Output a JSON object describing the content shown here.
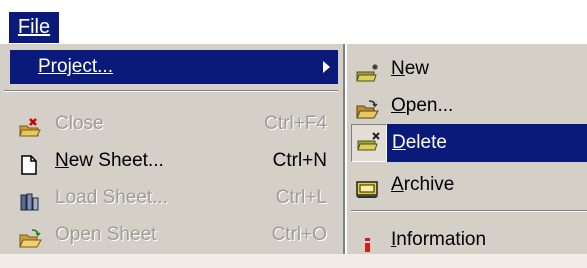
{
  "menubar": {
    "file_label": "File"
  },
  "file_menu": {
    "project_label": "Project...",
    "items": [
      {
        "label": "Close",
        "shortcut": "Ctrl+F4",
        "icon": "close-folder-icon",
        "enabled": false
      },
      {
        "label": "New Sheet...",
        "shortcut": "Ctrl+N",
        "icon": "new-sheet-icon",
        "enabled": true
      },
      {
        "label": "Load Sheet...",
        "shortcut": "Ctrl+L",
        "icon": "load-sheet-icon",
        "enabled": false
      },
      {
        "label": "Open Sheet",
        "shortcut": "Ctrl+O",
        "icon": "open-folder-icon",
        "enabled": false
      }
    ]
  },
  "project_submenu": {
    "items": [
      {
        "label": "New",
        "icon": "new-project-icon"
      },
      {
        "label": "Open...",
        "icon": "open-folder-icon"
      },
      {
        "label": "Delete",
        "icon": "delete-project-icon",
        "highlighted": true
      },
      {
        "label": "Archive",
        "icon": "archive-icon"
      },
      {
        "label": "Information",
        "icon": "information-icon"
      }
    ]
  },
  "colors": {
    "highlight": "#0a1a7a",
    "menu_face": "#d4d0c8",
    "disabled_text": "#a09c94"
  }
}
